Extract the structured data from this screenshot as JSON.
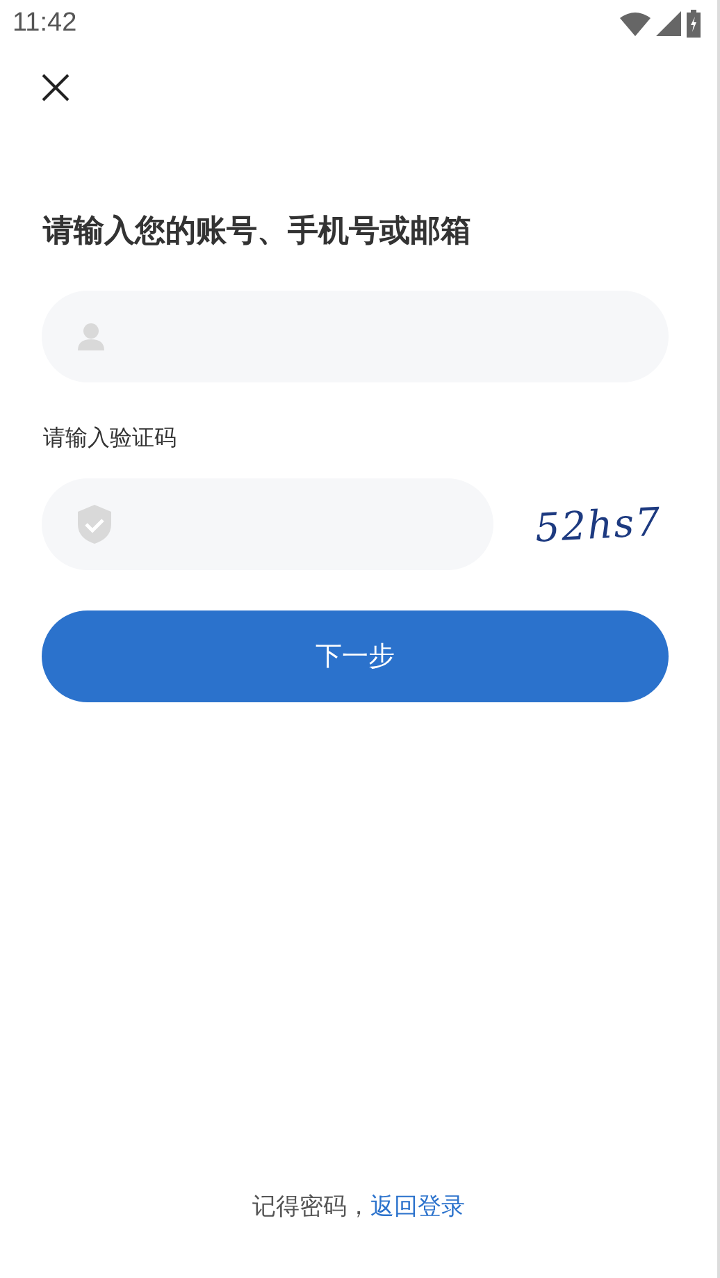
{
  "status_bar": {
    "time": "11:42"
  },
  "title": "请输入您的账号、手机号或邮箱",
  "captcha_label": "请输入验证码",
  "captcha_image": {
    "text": "52hs7"
  },
  "next_button": "下一步",
  "footer": {
    "text": "记得密码，",
    "link": "返回登录"
  }
}
